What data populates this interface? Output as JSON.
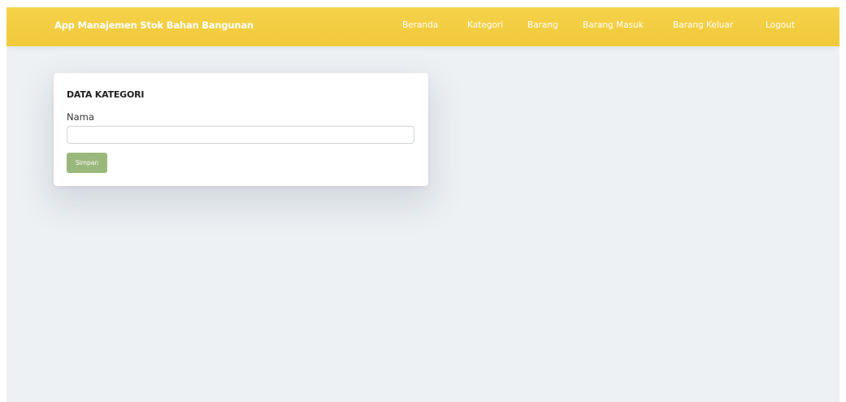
{
  "navbar": {
    "brand": "App Manajemen Stok Bahan Bangunan",
    "links": [
      {
        "label": "Beranda"
      },
      {
        "label": "Kategori"
      },
      {
        "label": "Barang"
      },
      {
        "label": "Barang Masuk"
      },
      {
        "label": "Barang Keluar"
      },
      {
        "label": "Logout"
      }
    ],
    "color": "#f3cd41"
  },
  "form": {
    "title": "DATA KATEGORI",
    "name_label": "Nama",
    "name_value": "",
    "save_label": "Simpan",
    "save_color": "#9ab87b"
  },
  "page": {
    "background": "#edf1f4"
  }
}
